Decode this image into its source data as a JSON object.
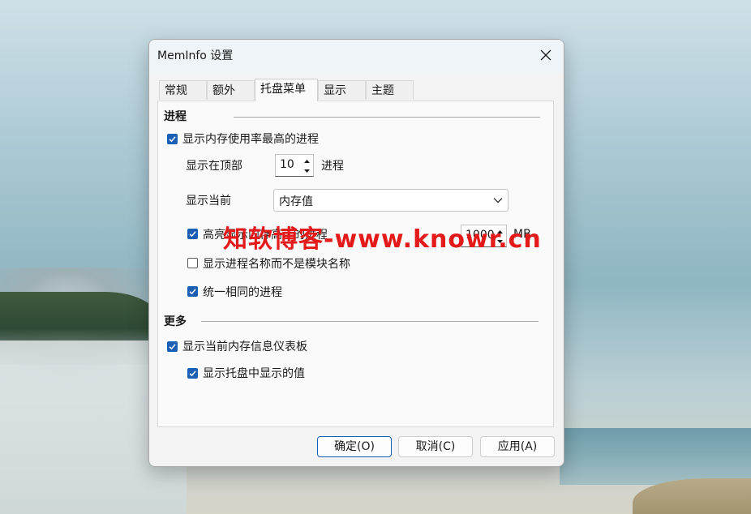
{
  "window": {
    "title": "MemInfo 设置"
  },
  "tabs": [
    {
      "label": "常规",
      "active": false
    },
    {
      "label": "额外",
      "active": false
    },
    {
      "label": "托盘菜单",
      "active": true
    },
    {
      "label": "显示",
      "active": false
    },
    {
      "label": "主题",
      "active": false
    }
  ],
  "processes_section": {
    "title": "进程",
    "show_top_process": {
      "label": "显示内存使用率最高的进程",
      "checked": true
    },
    "show_top": {
      "label": "显示在顶部",
      "value": "10",
      "suffix": "进程"
    },
    "show_current": {
      "label": "显示当前",
      "selected": "内存值"
    },
    "highlight": {
      "label": "高亮显示内存高于的进程",
      "checked": true,
      "value": "1000",
      "unit": "MB"
    },
    "show_process_name": {
      "label": "显示进程名称而不是模块名称",
      "checked": false
    },
    "unify_same": {
      "label": "统一相同的进程",
      "checked": true
    }
  },
  "more_section": {
    "title": "更多",
    "show_dashboard": {
      "label": "显示当前内存信息仪表板",
      "checked": true
    },
    "show_tray_values": {
      "label": "显示托盘中显示的值",
      "checked": true
    }
  },
  "buttons": {
    "ok": "确定(O)",
    "cancel": "取消(C)",
    "apply": "应用(A)"
  },
  "watermark": {
    "text": "知软博客-www.knowr.cn",
    "color": "#e41a1a"
  },
  "colors": {
    "accent": "#1a5fb4"
  }
}
